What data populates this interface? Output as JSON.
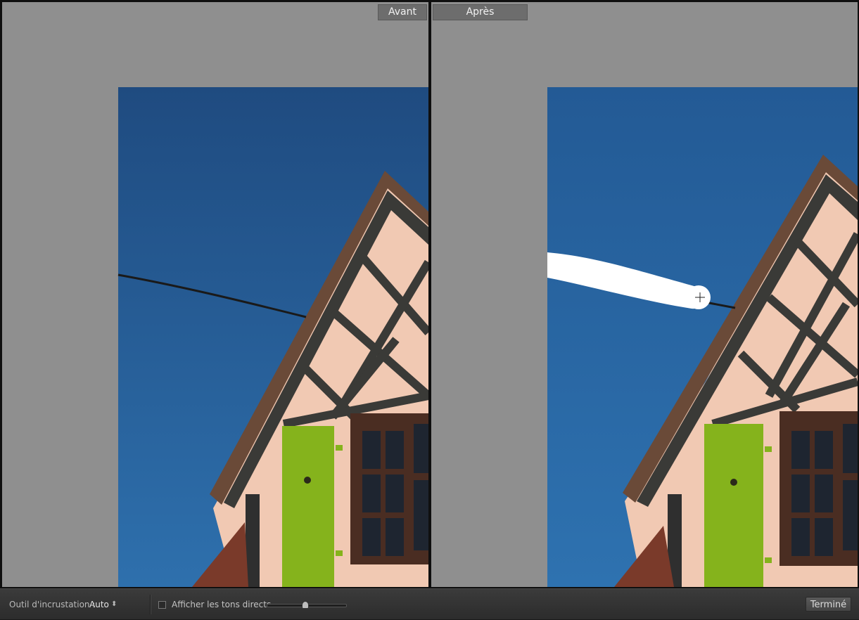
{
  "panes": {
    "before_label": "Avant",
    "after_label": "Après"
  },
  "toolbar": {
    "tool_label": "Outil d'incrustation :",
    "tool_value": "Auto",
    "overlay_label": "Afficher les tons directs",
    "overlay_checked": false,
    "done_label": "Terminé"
  },
  "colors": {
    "workspace_gray": "#8f8f8f",
    "sky_top": "#1f4b80",
    "sky_bottom": "#2e70ad",
    "shutter_green": "#85b31c",
    "wall_plaster": "#f1c9b3",
    "timber": "#3a3a37",
    "roof_edge": "#6a4a38",
    "brush_stroke": "#ffffff"
  },
  "icons": {
    "tool_arrows": "up-down-arrows-icon",
    "cursor": "crosshair-icon"
  }
}
